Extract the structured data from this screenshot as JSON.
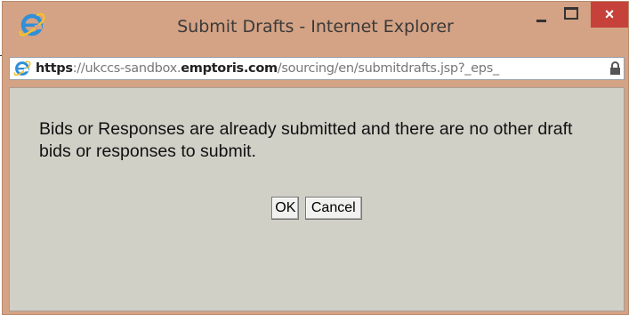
{
  "window": {
    "title": "Submit Drafts - Internet Explorer",
    "accent_color": "#d4a284",
    "close_color": "#c7413b"
  },
  "titlebar": {
    "icon": "internet-explorer-icon",
    "minimize_icon": "minimize-icon",
    "maximize_icon": "maximize-icon",
    "close_label": "×"
  },
  "address_bar": {
    "protocol": "https",
    "separator": "://",
    "subdomain": "ukccs-sandbox.",
    "domain": "emptoris.com",
    "path": "/sourcing/en/submitdrafts.jsp?_eps_",
    "lock_icon": "lock-icon"
  },
  "dialog": {
    "message": "Bids or Responses are already submitted and there are no other draft bids or responses to submit.",
    "ok_label": "OK",
    "cancel_label": "Cancel"
  }
}
